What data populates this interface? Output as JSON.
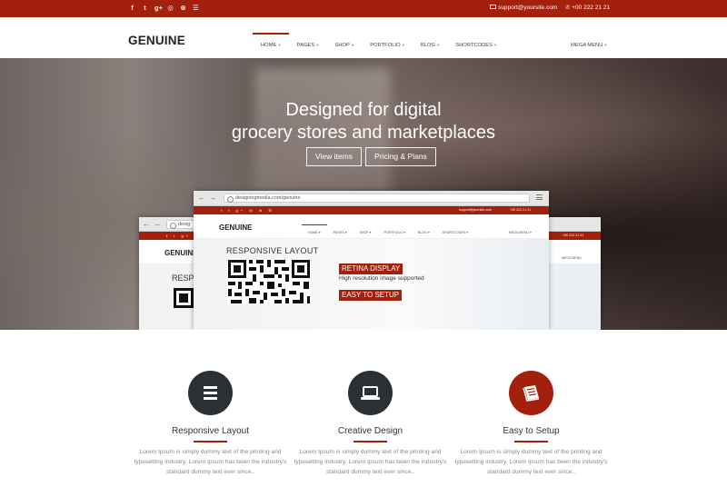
{
  "topbar": {
    "social_icons": [
      "facebook-icon",
      "twitter-icon",
      "google-plus-icon",
      "github-icon",
      "dribbble-icon",
      "rss-icon"
    ],
    "social_glyphs": [
      "f",
      "t",
      "g+",
      "◎",
      "⊛",
      "☰"
    ],
    "email": "support@yoursite.com",
    "phone": "+00 222 21 21"
  },
  "header": {
    "logo": "GENUINE",
    "nav": [
      {
        "label": "HOME",
        "active": true
      },
      {
        "label": "PAGES"
      },
      {
        "label": "SHOP"
      },
      {
        "label": "PORTFOLIO"
      },
      {
        "label": "BLOG"
      },
      {
        "label": "SHORTCODES"
      }
    ],
    "mega_menu": "MEGA MENU",
    "caret": "▾"
  },
  "hero": {
    "title_line1": "Designed for digital",
    "title_line2": "grocery stores and marketplaces",
    "button_view": "View items",
    "button_pricing": "Pricing & Plans"
  },
  "mockup_front": {
    "url": "designingmedia.com/genuine",
    "email": "support@yoursite.com",
    "phone": "+00 222 21 21",
    "logo": "GENUINE",
    "nav": [
      "HOME ▾",
      "PAGES ▾",
      "SHOP ▾",
      "PORTFOLIO ▾",
      "BLOG ▾",
      "SHORTCODES ▾"
    ],
    "mega_menu": "MEGA MENU ▾",
    "responsive_title": "RESPONSIVE LAYOUT",
    "retina_tag": "RETINA DISPLAY",
    "retina_sub": "High resolution image supported",
    "setup_tag": "EASY TO SETUP"
  },
  "mockup_back": {
    "url": "desig",
    "logo": "GENUINE",
    "responsive_partial": "RESP",
    "phone_partial": "+00 222 21 21",
    "mega_partial": "MEGA MENU"
  },
  "features": [
    {
      "icon": "bars-icon",
      "title": "Responsive Layout",
      "text": "Lorem Ipsum is simply dummy text of the printing and typesetting industry. Lorem Ipsum has been the industry's standard dummy text ever since.."
    },
    {
      "icon": "laptop-icon",
      "title": "Creative Design",
      "text": "Lorem Ipsum is simply dummy text of the printing and typesetting industry. Lorem Ipsum has been the industry's standard dummy text ever since.."
    },
    {
      "icon": "book-icon",
      "title": "Easy to Setup",
      "text": "Lorem Ipsum is simply dummy text of the printing and typesetting industry. Lorem Ipsum has been the industry's standard dummy text ever since.."
    }
  ],
  "colors": {
    "brand": "#a3200c",
    "dark": "#2b3035",
    "text_muted": "#888888"
  }
}
